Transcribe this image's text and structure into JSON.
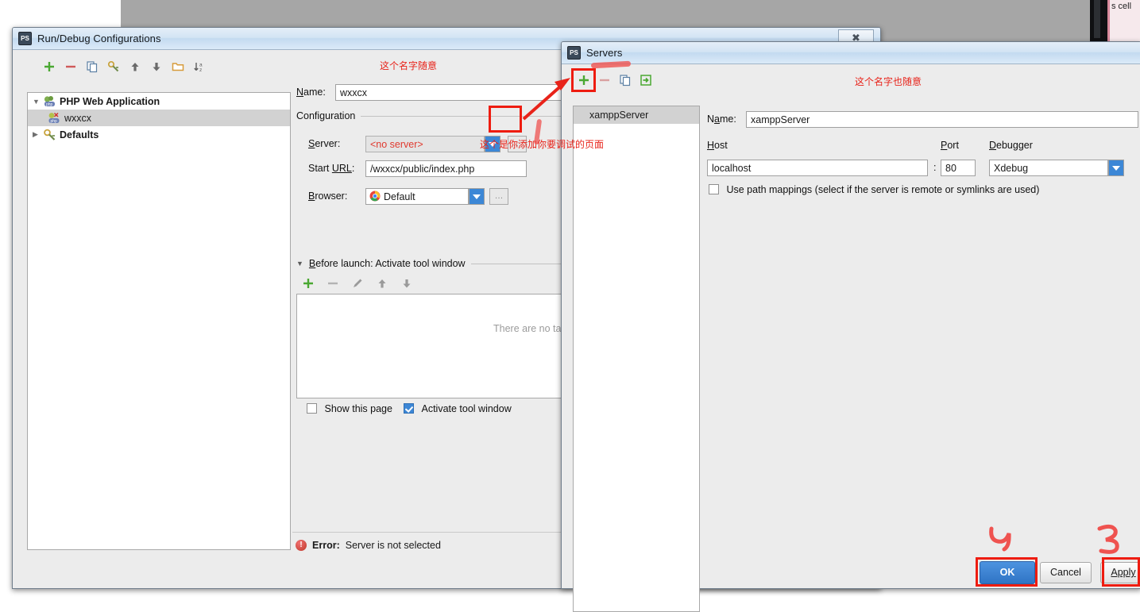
{
  "background": {
    "corner_text": "s cell"
  },
  "run_dialog": {
    "title": "Run/Debug Configurations",
    "app_icon": "phpstorm-icon",
    "close_label": "✖",
    "toolbar": [
      {
        "name": "add-configuration-button",
        "label": "+"
      },
      {
        "name": "remove-configuration-button",
        "label": "−"
      },
      {
        "name": "copy-configuration-button",
        "label": "copy"
      },
      {
        "name": "save-configuration-button",
        "label": "save"
      },
      {
        "name": "move-up-button",
        "label": "up"
      },
      {
        "name": "move-down-button",
        "label": "down"
      },
      {
        "name": "new-folder-button",
        "label": "folder"
      },
      {
        "name": "sort-alphabetically-button",
        "label": "sort"
      }
    ],
    "tree": [
      {
        "label": "PHP Web Application",
        "bold": true,
        "expanded": true,
        "selected": false,
        "icon": "php-web-app-icon"
      },
      {
        "label": "wxxcx",
        "bold": false,
        "child": true,
        "selected": true,
        "icon": "php-config-icon"
      },
      {
        "label": "Defaults",
        "bold": true,
        "expanded": false,
        "selected": false,
        "icon": "defaults-icon"
      }
    ],
    "name_label": "Name:",
    "name_value": "wxxcx",
    "configuration_group": "Configuration",
    "server_label": "Server:",
    "server_value": "<no server>",
    "start_url_label": "Start URL:",
    "start_url_value": "/wxxcx/public/index.php",
    "browser_label": "Browser:",
    "browser_value": "Default",
    "browser_icon": "chrome-icon",
    "before_launch_title": "Before launch: Activate tool window",
    "before_launch_toolbar": [
      {
        "name": "add-task-button",
        "label": "+"
      },
      {
        "name": "remove-task-button",
        "label": "−"
      },
      {
        "name": "edit-task-button",
        "label": "edit"
      },
      {
        "name": "task-move-up-button",
        "label": "up"
      },
      {
        "name": "task-move-down-button",
        "label": "down"
      }
    ],
    "no_tasks_text": "There are no tas",
    "show_page_label": "Show this page",
    "show_page_checked": false,
    "activate_tool_window_label": "Activate tool window",
    "activate_tool_window_checked": true,
    "error_prefix": "Error:",
    "error_text": "Server is not selected"
  },
  "servers_dialog": {
    "title": "Servers",
    "app_icon": "phpstorm-icon",
    "toolbar": [
      {
        "name": "add-server-button",
        "label": "+"
      },
      {
        "name": "remove-server-button",
        "label": "−"
      },
      {
        "name": "copy-server-button",
        "label": "copy"
      },
      {
        "name": "import-server-button",
        "label": "import"
      }
    ],
    "server_list": [
      {
        "label": "xamppServer",
        "selected": true
      }
    ],
    "name_label": "Name:",
    "name_value": "xamppServer",
    "host_label": "Host",
    "host_value": "localhost",
    "separator": ":",
    "port_label": "Port",
    "port_value": "80",
    "debugger_label": "Debugger",
    "debugger_value": "Xdebug",
    "path_mappings_label": "Use path mappings (select if the server is remote or symlinks are used)",
    "path_mappings_checked": false,
    "ok_label": "OK",
    "cancel_label": "Cancel",
    "apply_label": "Apply"
  },
  "annotations": {
    "name_note": "这个名字随意",
    "start_url_note": "这个是你添加你要调试的页面",
    "server_name_note": "这个名字也随意",
    "step_ok": "4",
    "step_apply": "3"
  },
  "colors": {
    "accent": "#3c87d6",
    "annotation_red": "#e8231a",
    "error_red": "#c0392b",
    "add_green": "#4aa832"
  }
}
